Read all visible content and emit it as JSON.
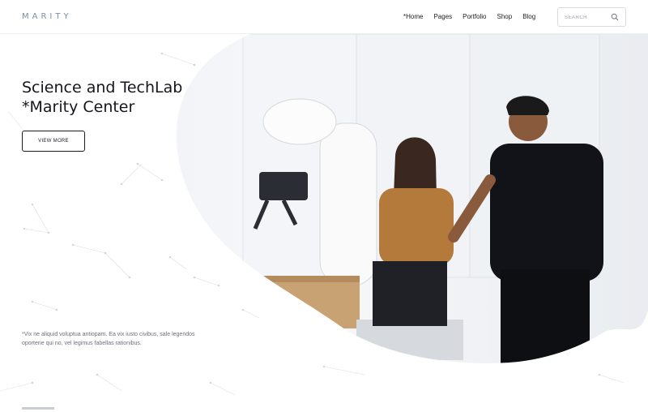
{
  "header": {
    "logo": "MARITY",
    "nav": [
      "*Home",
      "Pages",
      "Portfolio",
      "Shop",
      "Blog"
    ],
    "search_placeholder": "SEARCH"
  },
  "hero": {
    "title_line1": "Science and TechLab",
    "title_line2": "*Marity Center",
    "button_label": "VIEW MORE",
    "description": "*Vix ne aliquid voluptua antiopam. Ea vix iusto civibus, sale legendos oporterie qui no, vel legimus fabellas rationibus."
  },
  "colors": {
    "accent": "#7a8fa8",
    "text": "#14161c",
    "muted": "#6b707a"
  },
  "icons": {
    "search": "search-icon"
  }
}
